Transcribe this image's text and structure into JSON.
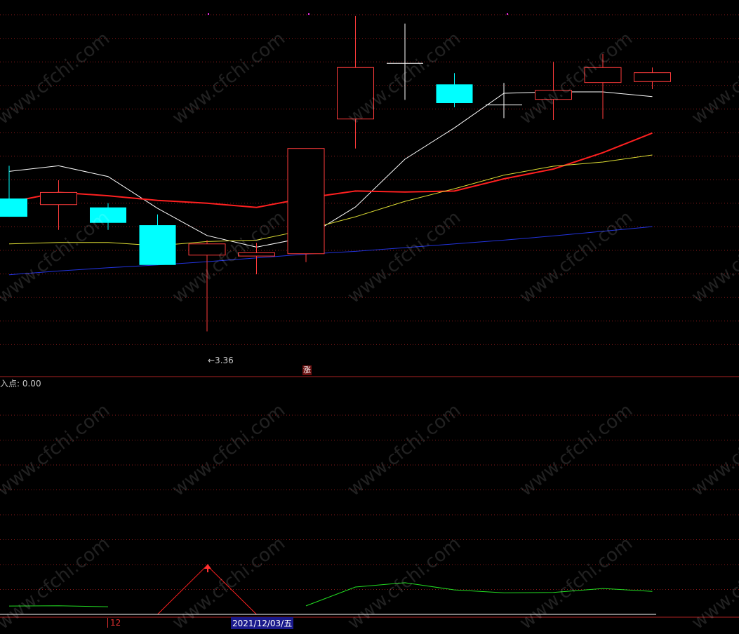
{
  "chart_data": [
    {
      "type": "candlestick",
      "panel": "main",
      "candles": [
        {
          "open": 6.2,
          "close": 5.81,
          "high": 6.9,
          "low": 5.81
        },
        {
          "open": 6.07,
          "close": 6.33,
          "high": 6.59,
          "low": 5.53
        },
        {
          "open": 6.01,
          "close": 5.68,
          "high": 6.1,
          "low": 5.53
        },
        {
          "open": 5.63,
          "close": 4.78,
          "high": 5.86,
          "low": 4.78
        },
        {
          "open": 4.99,
          "close": 5.23,
          "high": 5.31,
          "low": 3.36
        },
        {
          "open": 4.97,
          "close": 5.04,
          "high": 5.25,
          "low": 4.58
        },
        {
          "open": 5.02,
          "close": 7.27,
          "high": 7.27,
          "low": 4.84
        },
        {
          "open": 7.9,
          "close": 9.0,
          "high": 10.1,
          "low": 7.27
        },
        {
          "open": 9.09,
          "close": 9.09,
          "high": 9.94,
          "low": 8.31
        },
        {
          "open": 8.64,
          "close": 8.24,
          "high": 8.88,
          "low": 8.15
        },
        {
          "open": 8.2,
          "close": 8.2,
          "high": 8.67,
          "low": 7.92
        },
        {
          "open": 8.32,
          "close": 8.51,
          "high": 9.12,
          "low": 7.88
        },
        {
          "open": 8.68,
          "close": 9.0,
          "high": 9.29,
          "low": 7.9
        },
        {
          "open": 8.7,
          "close": 8.89,
          "high": 9.0,
          "low": 8.54
        }
      ],
      "bull_color": "#ff3b3b",
      "bear_color": "#00ffff",
      "doji_color": "#ffffff",
      "series": [
        {
          "color": "#ffffff",
          "values": [
            6.78,
            6.9,
            6.67,
            5.99,
            5.41,
            5.16,
            5.37,
            6.02,
            7.04,
            7.71,
            8.45,
            8.48,
            8.48,
            8.38
          ]
        },
        {
          "color": "#ff2020",
          "values": [
            6.12,
            6.33,
            6.26,
            6.16,
            6.1,
            6.01,
            6.21,
            6.36,
            6.34,
            6.36,
            6.62,
            6.83,
            7.18,
            7.6
          ]
        },
        {
          "color": "#dddd33",
          "values": [
            5.23,
            5.26,
            5.26,
            5.19,
            5.28,
            5.31,
            5.53,
            5.81,
            6.14,
            6.41,
            6.7,
            6.89,
            6.98,
            7.13
          ]
        },
        {
          "color": "#2233dd",
          "values": [
            4.57,
            4.65,
            4.72,
            4.78,
            4.85,
            4.93,
            5.01,
            5.07,
            5.15,
            5.23,
            5.31,
            5.4,
            5.5,
            5.6
          ]
        }
      ],
      "annotations": {
        "low_marker": "←3.36",
        "zhang_badge": "涨"
      }
    },
    {
      "type": "line",
      "panel": "indicator",
      "label": "入点: 0.00",
      "series": [
        {
          "color": "#22dd22",
          "values": [
            5.8,
            6.0,
            5.3,
            null,
            null,
            null,
            5.9,
            19.0,
            22.0,
            17.0,
            15.0,
            15.2,
            18.0,
            16.0
          ]
        },
        {
          "color": "#ff2020",
          "values": [
            null,
            null,
            null,
            0,
            34,
            0,
            null,
            null,
            null,
            null,
            null,
            null,
            null,
            null
          ]
        }
      ],
      "ylim": [
        0,
        40
      ]
    }
  ],
  "x_axis": {
    "tick_label": "12",
    "cursor_label": "2021/12/03/五"
  },
  "watermark": "www.cfchi.com",
  "colors": {
    "background": "#000000",
    "grid": "#8b1a1a",
    "divider": "#aa2222"
  }
}
